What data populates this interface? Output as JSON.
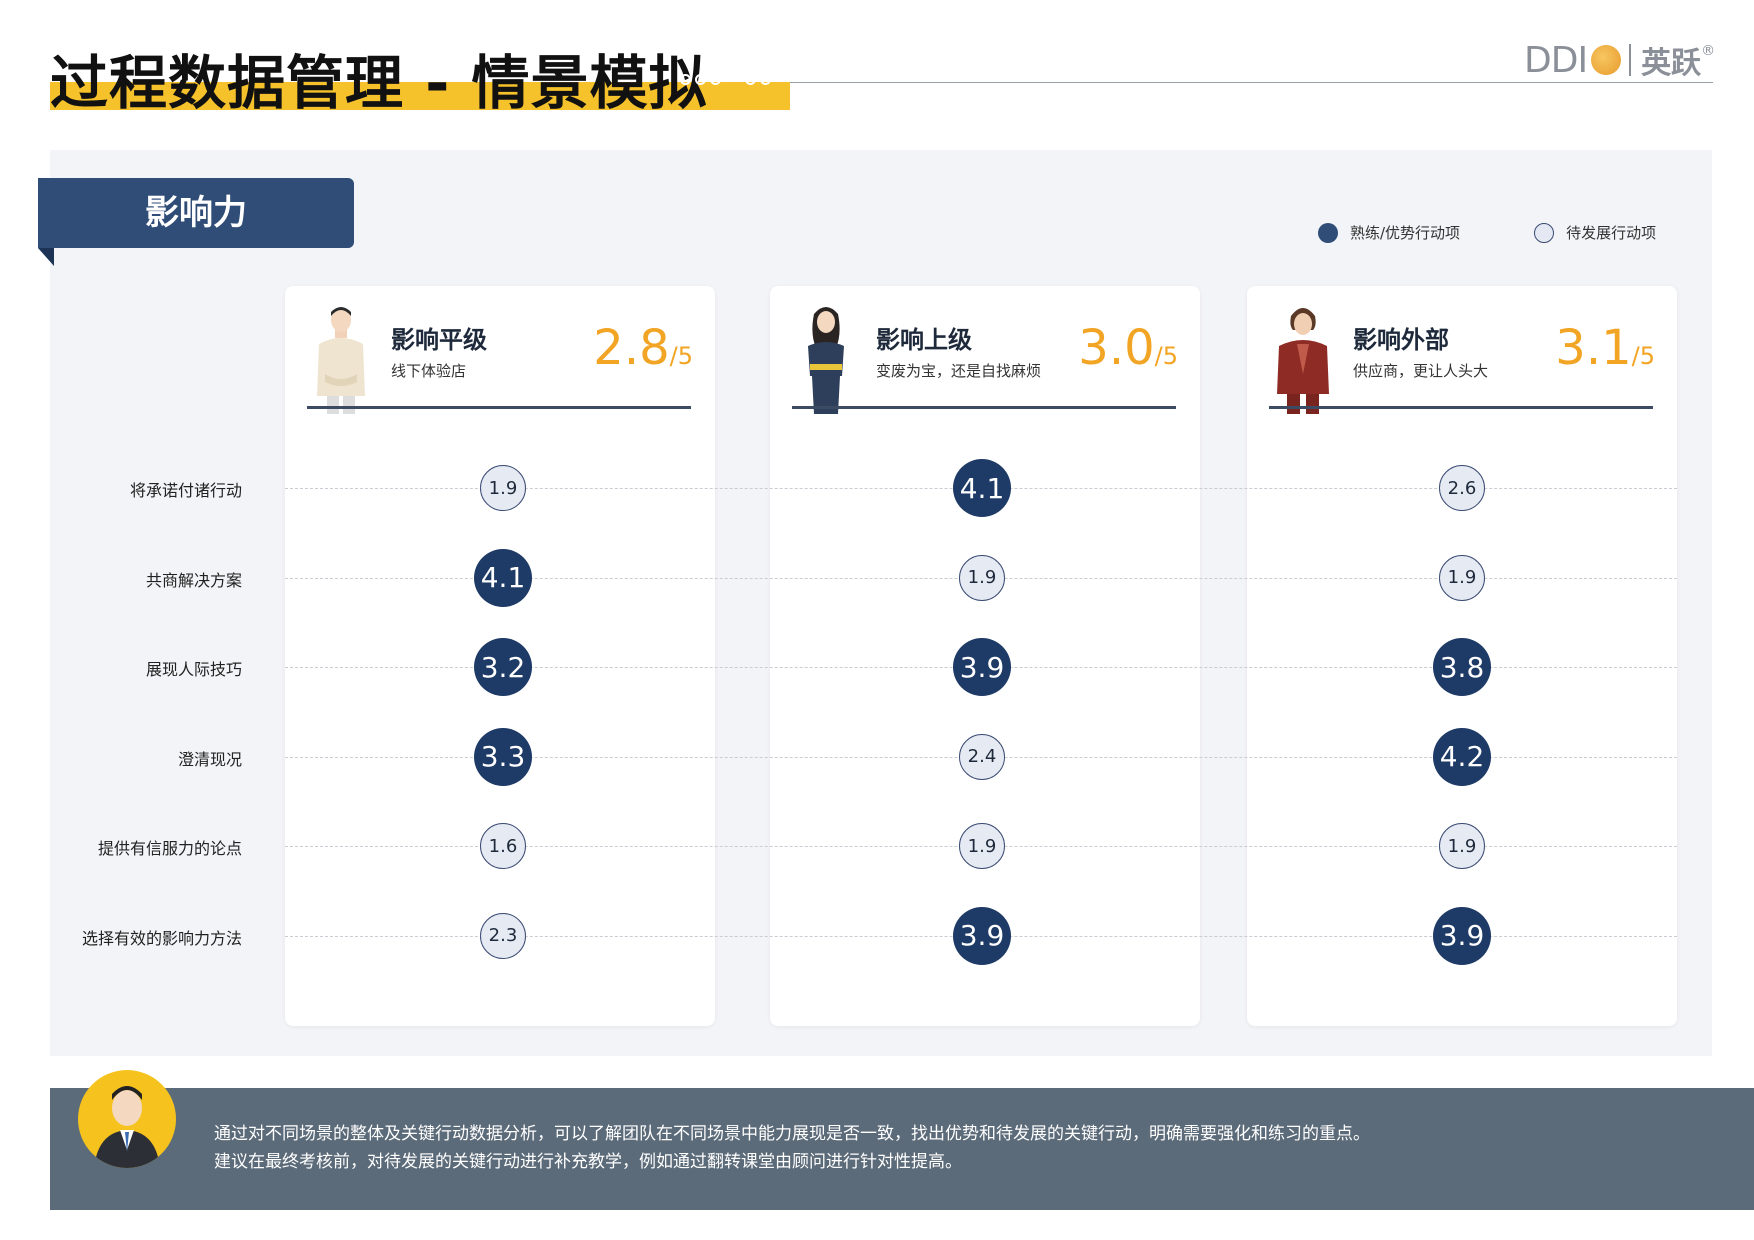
{
  "header": {
    "title": "过程数据管理 - 情景模拟",
    "logo_text": "DDI",
    "logo_cn": "英跃",
    "logo_mark": "®"
  },
  "section": {
    "title": "影响力"
  },
  "legend": {
    "strong_label": "熟练/优势行动项",
    "weak_label": "待发展行动项"
  },
  "colors": {
    "brand_navy": "#1e3a66",
    "accent_yellow": "#f6c22b",
    "score_orange": "#f2a424",
    "weak_fill": "#e6eaf3",
    "footer_bg": "#5c6b79"
  },
  "chart_data": {
    "type": "dot-matrix",
    "threshold_note": "",
    "rows": [
      "将承诺付诸行动",
      "共商解决方案",
      "展现人际技巧",
      "澄清现况",
      "提供有信服力的论点",
      "选择有效的影响力方法"
    ],
    "series": [
      {
        "name": "影响平级",
        "subtitle": "线下体验店",
        "score": "2.8",
        "score_max": "/5",
        "values": [
          1.9,
          4.1,
          3.2,
          3.3,
          1.6,
          2.3
        ],
        "strong": [
          false,
          true,
          true,
          true,
          false,
          false
        ]
      },
      {
        "name": "影响上级",
        "subtitle": "变废为宝，还是自找麻烦",
        "score": "3.0",
        "score_max": "/5",
        "values": [
          4.1,
          1.9,
          3.9,
          2.4,
          1.9,
          3.9
        ],
        "strong": [
          true,
          false,
          true,
          false,
          false,
          true
        ]
      },
      {
        "name": "影响外部",
        "subtitle": "供应商，更让人头大",
        "score": "3.1",
        "score_max": "/5",
        "values": [
          2.6,
          1.9,
          3.8,
          4.2,
          1.9,
          3.9
        ],
        "strong": [
          false,
          false,
          true,
          true,
          false,
          true
        ]
      }
    ]
  },
  "footer": {
    "line1": "通过对不同场景的整体及关键行动数据分析，可以了解团队在不同场景中能力展现是否一致，找出优势和待发展的关键行动，明确需要强化和练习的重点。",
    "line2": "建议在最终考核前，对待发展的关键行动进行补充教学，例如通过翻转课堂由顾问进行针对性提高。"
  }
}
